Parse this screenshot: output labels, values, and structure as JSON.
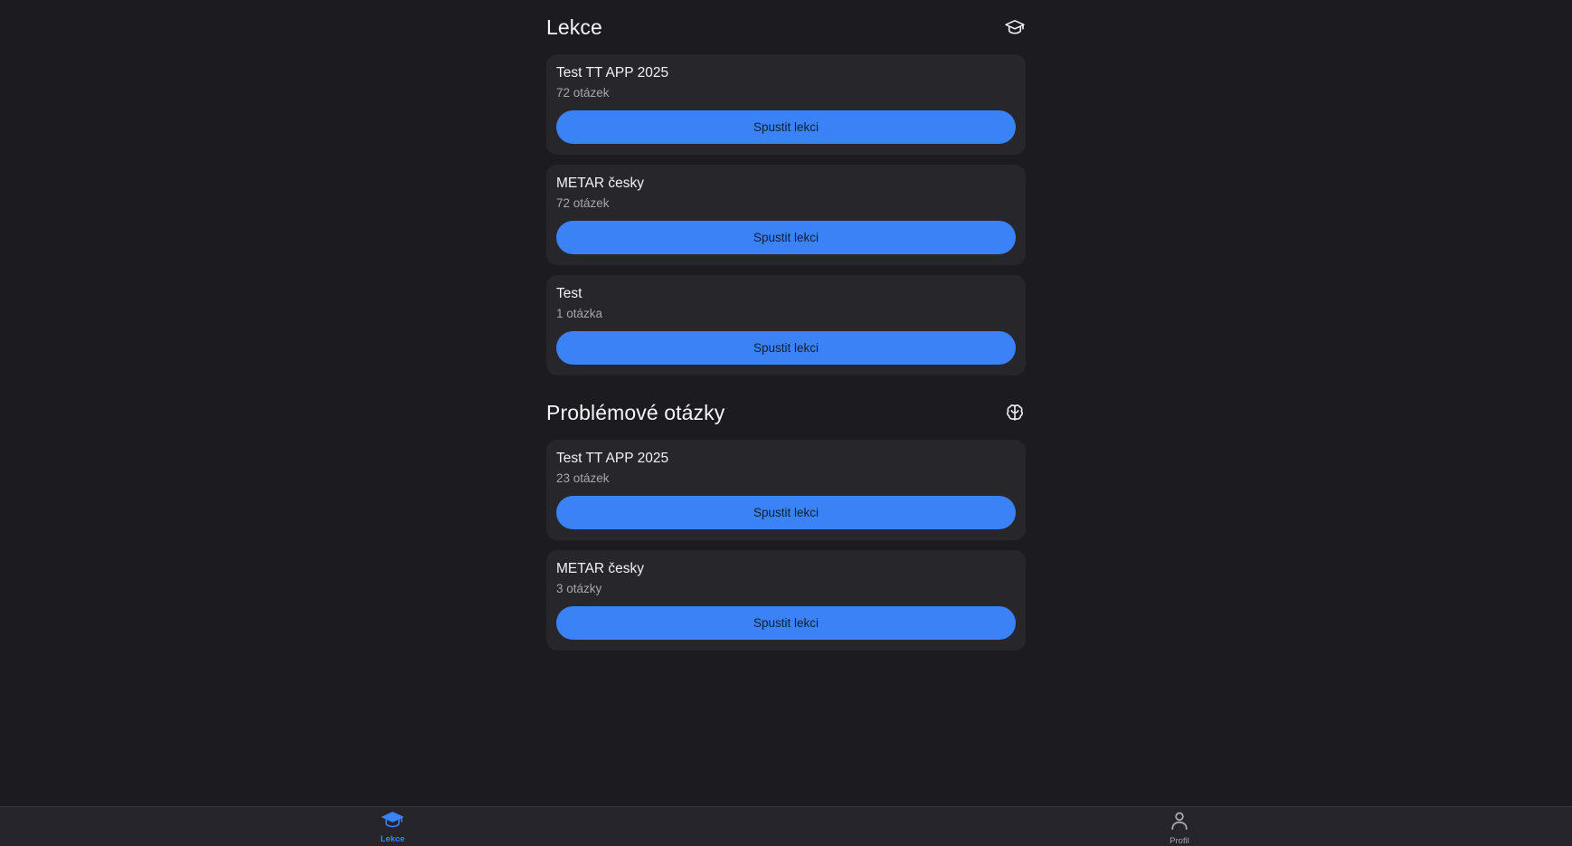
{
  "sections": {
    "lessons": {
      "title": "Lekce",
      "icon": "graduation-cap-icon",
      "items": [
        {
          "title": "Test TT APP 2025",
          "count": "72 otázek",
          "button_label": "Spustit lekci"
        },
        {
          "title": "METAR česky",
          "count": "72 otázek",
          "button_label": "Spustit lekci"
        },
        {
          "title": "Test",
          "count": "1 otázka",
          "button_label": "Spustit lekci"
        }
      ]
    },
    "problems": {
      "title": "Problémové otázky",
      "icon": "brain-icon",
      "items": [
        {
          "title": "Test TT APP 2025",
          "count": "23 otázek",
          "button_label": "Spustit lekci"
        },
        {
          "title": "METAR česky",
          "count": "3 otázky",
          "button_label": "Spustit lekci"
        }
      ]
    }
  },
  "bottom_nav": {
    "items": [
      {
        "label": "Lekce",
        "icon": "graduation-cap-icon",
        "active": true
      },
      {
        "label": "Profil",
        "icon": "user-icon",
        "active": false
      }
    ]
  },
  "colors": {
    "background": "#1c1c20",
    "card": "#26262b",
    "accent": "#3b82f6",
    "nav_background": "#25252b"
  }
}
